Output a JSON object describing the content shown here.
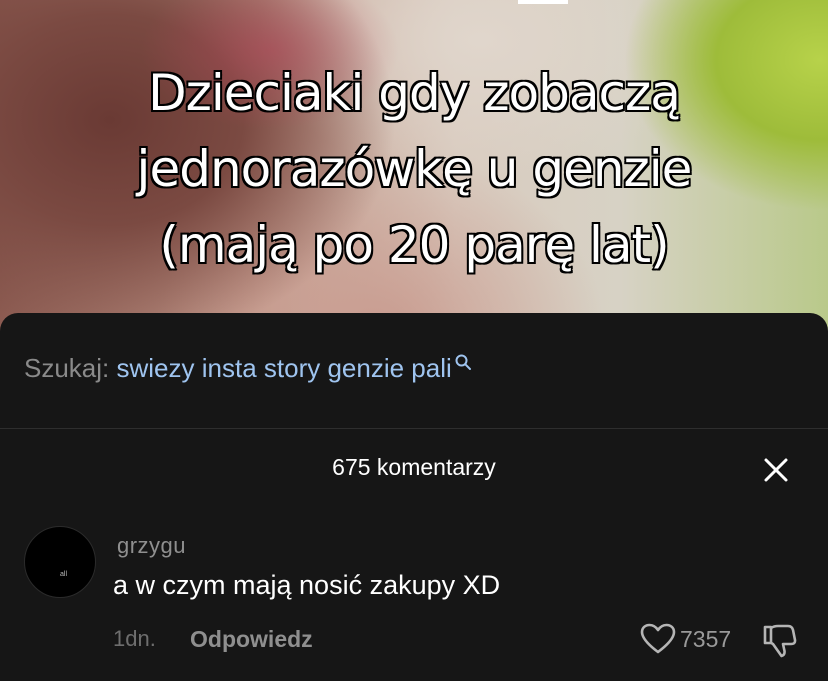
{
  "caption": {
    "lines": [
      "Dzieciaki gdy zobaczą",
      "jednorazówkę u genzie",
      "(mają po 20 parę lat)"
    ]
  },
  "search": {
    "label": "Szukaj:",
    "query": "swiezy insta story genzie pali"
  },
  "comments_header": {
    "count_text": "675 komentarzy"
  },
  "comment": {
    "avatar_text": "all",
    "username": "grzygu",
    "text": "a w czym mają nosić zakupy XD",
    "time": "1dn.",
    "reply_label": "Odpowiedz",
    "likes": "7357"
  },
  "colors": {
    "sheet_bg": "#161616",
    "search_query": "#9fc4ef",
    "muted": "#8f8f8f"
  },
  "icons": [
    "search-icon",
    "close-icon",
    "heart-icon",
    "thumbs-down-icon"
  ]
}
